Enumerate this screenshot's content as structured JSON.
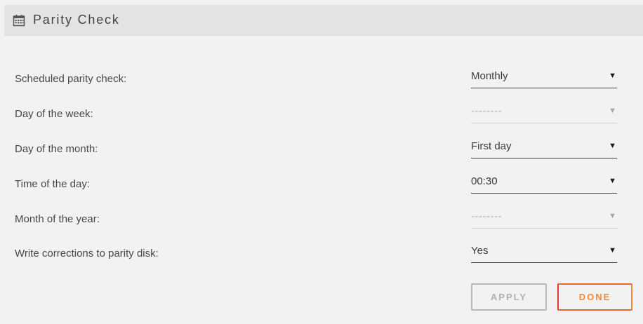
{
  "header": {
    "title": "Parity Check",
    "icon": "calendar-icon"
  },
  "settings": [
    {
      "label": "Scheduled parity check:",
      "value": "Monthly",
      "enabled": true
    },
    {
      "label": "Day of the week:",
      "value": "--------",
      "enabled": false
    },
    {
      "label": "Day of the month:",
      "value": "First day",
      "enabled": true
    },
    {
      "label": "Time of the day:",
      "value": "00:30",
      "enabled": true
    },
    {
      "label": "Month of the year:",
      "value": "--------",
      "enabled": false
    },
    {
      "label": "Write corrections to parity disk:",
      "value": "Yes",
      "enabled": true
    }
  ],
  "caret": "▼",
  "buttons": {
    "apply": "APPLY",
    "done": "DONE"
  },
  "colors": {
    "background": "#f2f2f2",
    "header_bg": "#e4e4e4",
    "done_accent": "#f08a3a",
    "done_accent_start": "#e0382a",
    "apply_disabled": "#b8b8b8"
  }
}
